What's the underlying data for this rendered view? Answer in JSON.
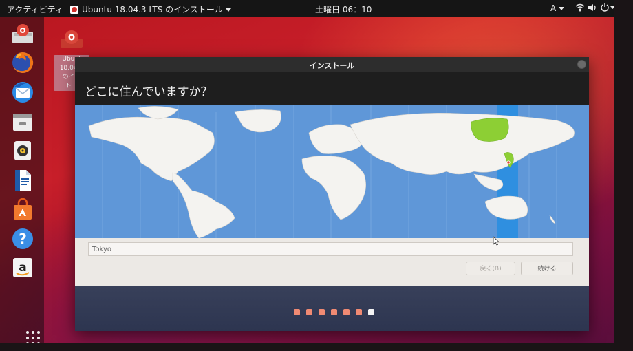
{
  "topbar": {
    "activities": "アクティビティ",
    "app_menu": "Ubuntu 18.04.3 LTS のインストール",
    "clock": "土曜日 06：10",
    "input_indicator": "A",
    "icons": [
      "wifi-icon",
      "volume-icon",
      "power-icon"
    ]
  },
  "dock": {
    "items": [
      "installer-icon",
      "firefox-icon",
      "thunderbird-icon",
      "files-icon",
      "rhythmbox-icon",
      "libreoffice-writer-icon",
      "software-center-icon",
      "help-icon",
      "amazon-icon"
    ],
    "show_apps": "app-grid-icon"
  },
  "desktop_icon": {
    "label_lines": [
      "Ubunt",
      "18.04.3",
      "のイン",
      "トー"
    ]
  },
  "installer": {
    "window_title": "インストール",
    "heading": "どこに住んでいますか？",
    "timezone_value": "Tokyo",
    "back_button": "戻る(B)",
    "next_button": "続ける",
    "progress": {
      "total_steps": 7,
      "current_step": 7
    }
  },
  "colors": {
    "desktop_red": "#c81f2a",
    "ocean": "#5f97d8",
    "land": "#f4f3f0",
    "selected_zone": "#2f8fe0",
    "highlight_land": "#8dcf34",
    "progress_dot": "#f08a73"
  }
}
